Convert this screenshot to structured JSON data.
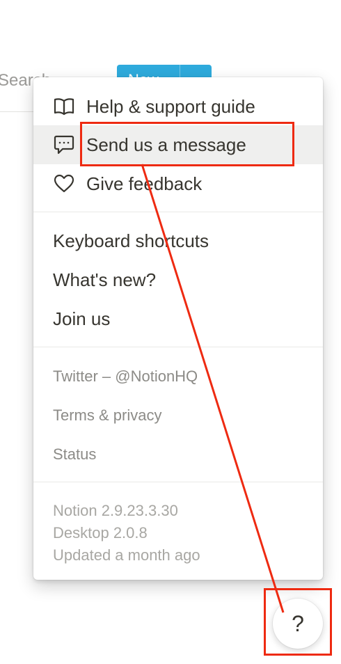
{
  "background": {
    "search_label": "Search",
    "new_button_label": "New",
    "new_button_arrow": "⌄"
  },
  "menu": {
    "primary": [
      {
        "label": "Help & support guide",
        "icon": "book-icon"
      },
      {
        "label": "Send us a message",
        "icon": "chat-bubble-icon",
        "highlighted": true
      },
      {
        "label": "Give feedback",
        "icon": "heart-icon"
      }
    ],
    "secondary": [
      {
        "label": "Keyboard shortcuts"
      },
      {
        "label": "What's new?"
      },
      {
        "label": "Join us"
      }
    ],
    "links": [
      {
        "label": "Twitter – @NotionHQ"
      },
      {
        "label": "Terms & privacy"
      },
      {
        "label": "Status"
      }
    ],
    "version": {
      "app": "Notion 2.9.23.3.30",
      "desktop": "Desktop 2.0.8",
      "updated": "Updated a month ago"
    }
  },
  "help_button": {
    "label": "?"
  },
  "colors": {
    "annotation": "#ee2a11",
    "accent": "#2eaadc",
    "highlight": "#efefee"
  }
}
